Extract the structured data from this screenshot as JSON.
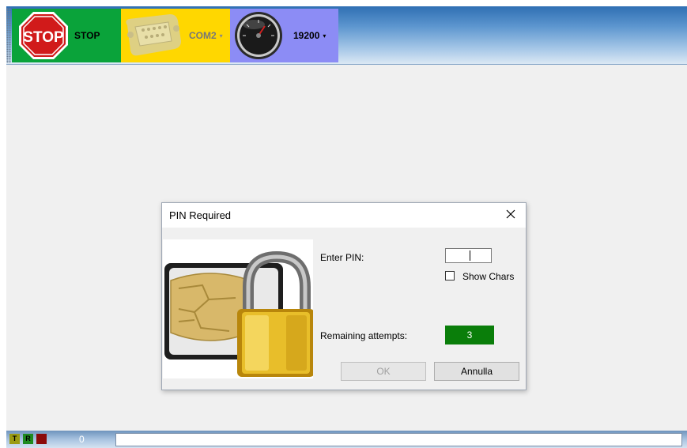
{
  "toolbar": {
    "stop": {
      "icon_text": "STOP",
      "label": "STOP"
    },
    "port": {
      "label": "COM2",
      "arrow": "▾"
    },
    "baud": {
      "label": "19200",
      "arrow": "▾"
    }
  },
  "dialog": {
    "title": "PIN Required",
    "enter_pin_label": "Enter PIN:",
    "pin_value": "",
    "show_chars_label": "Show Chars",
    "show_chars_checked": false,
    "remaining_label": "Remaining attempts:",
    "remaining_value": "3",
    "ok_label": "OK",
    "cancel_label": "Annulla"
  },
  "statusbar": {
    "led_t": "T",
    "led_r": "R",
    "counter": "0",
    "status_text": ""
  },
  "colors": {
    "stop_bg": "#0aa33a",
    "port_bg": "#ffd700",
    "baud_bg": "#8c8cf5",
    "attempts_bg": "#0a7e0a"
  }
}
